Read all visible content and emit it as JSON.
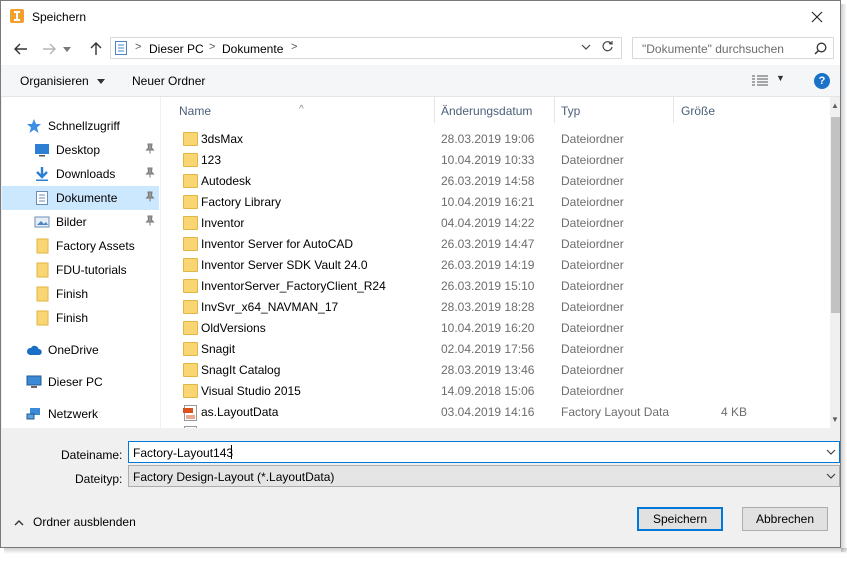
{
  "window": {
    "title": "Speichern"
  },
  "navigation": {
    "breadcrumb": [
      "Dieser PC",
      "Dokumente"
    ],
    "search_placeholder": "\"Dokumente\" durchsuchen"
  },
  "toolbar": {
    "organize_label": "Organisieren",
    "new_folder_label": "Neuer Ordner"
  },
  "sidebar": {
    "items": [
      {
        "label": "Schnellzugriff",
        "icon": "star-icon"
      },
      {
        "label": "Desktop",
        "icon": "desktop-icon",
        "pinned": true
      },
      {
        "label": "Downloads",
        "icon": "download-icon",
        "pinned": true
      },
      {
        "label": "Dokumente",
        "icon": "document-icon",
        "pinned": true,
        "selected": true
      },
      {
        "label": "Bilder",
        "icon": "pictures-icon",
        "pinned": true
      },
      {
        "label": "Factory Assets",
        "icon": "folder-icon"
      },
      {
        "label": "FDU-tutorials",
        "icon": "folder-icon"
      },
      {
        "label": "Finish",
        "icon": "folder-icon"
      },
      {
        "label": "Finish",
        "icon": "folder-icon"
      },
      {
        "label": "OneDrive",
        "icon": "cloud-icon"
      },
      {
        "label": "Dieser PC",
        "icon": "computer-icon"
      },
      {
        "label": "Netzwerk",
        "icon": "network-icon"
      }
    ]
  },
  "file_list": {
    "columns": [
      "Name",
      "Änderungsdatum",
      "Typ",
      "Größe"
    ],
    "rows": [
      {
        "name": "3dsMax",
        "date": "28.03.2019 19:06",
        "type": "Dateiordner",
        "size": ""
      },
      {
        "name": "123",
        "date": "10.04.2019 10:33",
        "type": "Dateiordner",
        "size": ""
      },
      {
        "name": "Autodesk",
        "date": "26.03.2019 14:58",
        "type": "Dateiordner",
        "size": ""
      },
      {
        "name": "Factory Library",
        "date": "10.04.2019 16:21",
        "type": "Dateiordner",
        "size": ""
      },
      {
        "name": "Inventor",
        "date": "04.04.2019 14:22",
        "type": "Dateiordner",
        "size": ""
      },
      {
        "name": "Inventor Server for AutoCAD",
        "date": "26.03.2019 14:47",
        "type": "Dateiordner",
        "size": ""
      },
      {
        "name": "Inventor Server SDK Vault 24.0",
        "date": "26.03.2019 14:19",
        "type": "Dateiordner",
        "size": ""
      },
      {
        "name": "InventorServer_FactoryClient_R24",
        "date": "26.03.2019 15:10",
        "type": "Dateiordner",
        "size": ""
      },
      {
        "name": "InvSvr_x64_NAVMAN_17",
        "date": "28.03.2019 18:28",
        "type": "Dateiordner",
        "size": ""
      },
      {
        "name": "OldVersions",
        "date": "10.04.2019 16:20",
        "type": "Dateiordner",
        "size": ""
      },
      {
        "name": "Snagit",
        "date": "02.04.2019 17:56",
        "type": "Dateiordner",
        "size": ""
      },
      {
        "name": "SnagIt Catalog",
        "date": "28.03.2019 13:46",
        "type": "Dateiordner",
        "size": ""
      },
      {
        "name": "Visual Studio 2015",
        "date": "14.09.2018 15:06",
        "type": "Dateiordner",
        "size": ""
      },
      {
        "name": "as.LayoutData",
        "date": "03.04.2019 14:16",
        "type": "Factory Layout Data",
        "size": "4 KB"
      }
    ]
  },
  "form": {
    "filename_label": "Dateiname:",
    "filename_value": "Factory-Layout143",
    "filetype_label": "Dateityp:",
    "filetype_value": "Factory Design-Layout (*.LayoutData)"
  },
  "footer": {
    "hide_folders_label": "Ordner ausblenden",
    "save_label": "Speichern",
    "cancel_label": "Abbrechen"
  },
  "colors": {
    "accent": "#0078d7",
    "selection": "#cce8ff",
    "folder": "#f7d673",
    "help": "#1a73c8"
  }
}
